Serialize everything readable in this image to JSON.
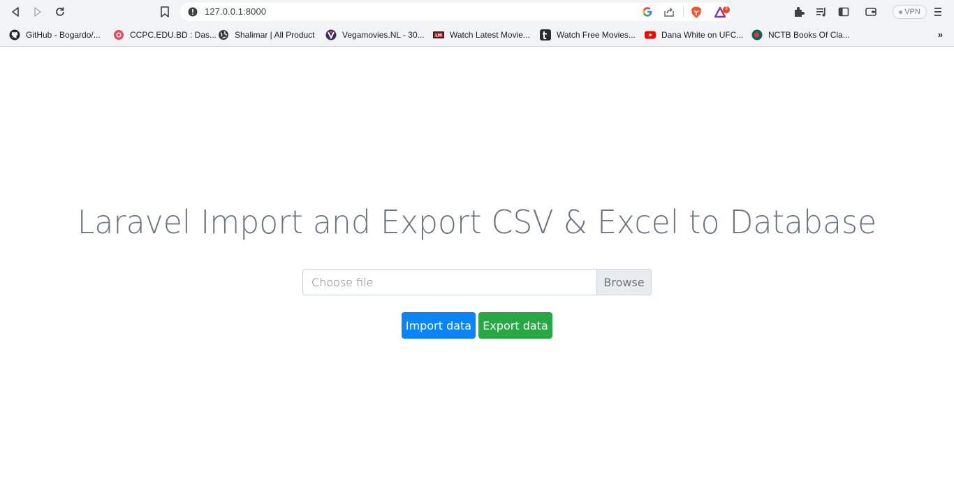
{
  "browser": {
    "url": "127.0.0.1:8000",
    "vpn_label": "VPN",
    "rewards_badge": "3",
    "bookmarks": [
      {
        "label": "GitHub - Bogardo/...",
        "icon": "github-icon"
      },
      {
        "label": "CCPC.EDU.BD : Das...",
        "icon": "ccpc-icon"
      },
      {
        "label": "Shalimar | All Product",
        "icon": "globe-icon"
      },
      {
        "label": "Vegamovies.NL - 30...",
        "icon": "vegamovies-icon"
      },
      {
        "label": "Watch Latest Movie...",
        "icon": "lm-icon"
      },
      {
        "label": "Watch Free Movies...",
        "icon": "t-icon"
      },
      {
        "label": "Dana White on UFC...",
        "icon": "youtube-icon"
      },
      {
        "label": "NCTB Books Of Cla...",
        "icon": "nctb-icon"
      }
    ],
    "bookmarks_more": "»"
  },
  "page": {
    "heading": "Laravel Import and Export CSV & Excel to Database",
    "file_placeholder": "Choose file",
    "browse_label": "Browse",
    "import_label": "Import data",
    "export_label": "Export data"
  },
  "colors": {
    "primary": "#0d84f5",
    "success": "#28a745",
    "heading": "#6c757d"
  }
}
